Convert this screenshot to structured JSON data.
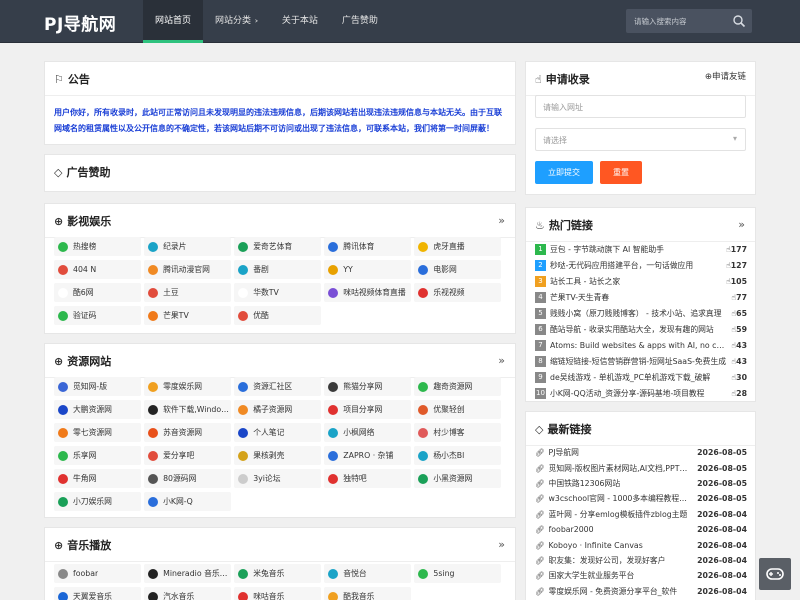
{
  "header": {
    "logo": "PJ导航网",
    "nav": [
      "网站首页",
      "网站分类",
      "关于本站",
      "广告赞助"
    ],
    "search_placeholder": "请输入搜索内容"
  },
  "notice": {
    "title": "公告",
    "text": "用户你好，所有收录时，此站可正常访问且未发现明显的违法违规信息，后期该网站若出现违法违规信息与本站无关。由于互联网域名的租赁属性以及公开信息的不确定性，若该网站后期不可访问或出现了违法信息，可联系本站，我们将第一时间屏蔽！"
  },
  "ads": {
    "title": "广告赞助"
  },
  "film": {
    "title": "影视娱乐",
    "links": [
      {
        "label": "热搜榜",
        "color": "#2db84d",
        "icon": "play-icon"
      },
      {
        "label": "纪录片",
        "color": "#1aa3c7",
        "icon": "tv-icon"
      },
      {
        "label": "爱奇艺体育",
        "color": "#1aa058",
        "icon": "tv-icon"
      },
      {
        "label": "腾讯体育",
        "color": "#2a6edb",
        "icon": "sport-icon"
      },
      {
        "label": "虎牙直播",
        "color": "#f0b400",
        "icon": "huya-icon"
      },
      {
        "label": "404 N",
        "color": "#e14c3c",
        "icon": "chrome-icon"
      },
      {
        "label": "腾讯动漫官网",
        "color": "#f08a24",
        "icon": "comic-icon"
      },
      {
        "label": "番剧",
        "color": "#1aa3c7",
        "icon": "tv-icon"
      },
      {
        "label": "YY",
        "color": "#e8a100",
        "icon": "yy-icon"
      },
      {
        "label": "电影网",
        "color": "#2a6edb",
        "icon": "film-icon"
      },
      {
        "label": "酷6网",
        "color": "#ffffff",
        "icon": "blank-icon"
      },
      {
        "label": "土豆",
        "color": "#e14c3c",
        "icon": "chrome-icon"
      },
      {
        "label": "华数TV",
        "color": "#ffffff",
        "icon": "blank-icon"
      },
      {
        "label": "咪咕视频体育直播",
        "color": "#7a4fd6",
        "icon": "migu-icon"
      },
      {
        "label": "乐视视频",
        "color": "#e0312f",
        "icon": "le-icon"
      },
      {
        "label": "验证码",
        "color": "#2db84d",
        "icon": "play-icon"
      },
      {
        "label": "芒果TV",
        "color": "#f07a1a",
        "icon": "mango-icon"
      },
      {
        "label": "优酷",
        "color": "#e14c3c",
        "icon": "chrome-icon"
      }
    ]
  },
  "resources": {
    "title": "资源网站",
    "links": [
      {
        "label": "觅知网-版",
        "color": "#3a66d6",
        "icon": "triangle-icon"
      },
      {
        "label": "零度娱乐网",
        "color": "#f0a020",
        "icon": "zero-icon"
      },
      {
        "label": "资源汇社区",
        "color": "#2a6edb",
        "icon": "wordpress-icon"
      },
      {
        "label": "熊猫分享网",
        "color": "#3a3a3a",
        "icon": "panda-icon"
      },
      {
        "label": "趣奇资源网",
        "color": "#2db84d",
        "icon": "qq-icon"
      },
      {
        "label": "大鹏资源网",
        "color": "#1a46c8",
        "icon": "bird-icon"
      },
      {
        "label": "软件下载,Windows软件",
        "color": "#222222",
        "icon": "apple-icon"
      },
      {
        "label": "橘子资源网",
        "color": "#f08a24",
        "icon": "orange-icon"
      },
      {
        "label": "项目分享网",
        "color": "#e0312f",
        "icon": "project-icon"
      },
      {
        "label": "优聚轻创",
        "color": "#e05a2a",
        "icon": "youju-icon"
      },
      {
        "label": "零七资源网",
        "color": "#f07a1a",
        "icon": "seven-icon"
      },
      {
        "label": "苏音资源网",
        "color": "#e8501a",
        "icon": "suyin-icon"
      },
      {
        "label": "个人笔记",
        "color": "#1a46c8",
        "icon": "note-icon"
      },
      {
        "label": "小枫网络",
        "color": "#1aa3c7",
        "icon": "leaf-icon"
      },
      {
        "label": "村少博客",
        "color": "#e05a5a",
        "icon": "village-icon"
      },
      {
        "label": "乐享网",
        "color": "#2db84d",
        "icon": "share-icon"
      },
      {
        "label": "爱分享吧",
        "color": "#e14c3c",
        "icon": "chrome-icon"
      },
      {
        "label": "果核剥壳",
        "color": "#d4a21a",
        "icon": "nut-icon"
      },
      {
        "label": "ZAPRO · 杂铺",
        "color": "#2a6edb",
        "icon": "zapro-icon"
      },
      {
        "label": "杨小杰Bl",
        "color": "#1aa3c7",
        "icon": "yang-icon"
      },
      {
        "label": "牛角网",
        "color": "#e0312f",
        "icon": "horn-icon"
      },
      {
        "label": "80源码网",
        "color": "#555555",
        "icon": "code-icon"
      },
      {
        "label": "3yi论坛",
        "color": "#cccccc",
        "icon": "forum-icon"
      },
      {
        "label": "独特吧",
        "color": "#e0312f",
        "icon": "unique-icon"
      },
      {
        "label": "小黑资源网",
        "color": "#1aa058",
        "icon": "black-icon"
      },
      {
        "label": "小刀娱乐网",
        "color": "#1aa058",
        "icon": "knife-icon"
      },
      {
        "label": "小K网-Q",
        "color": "#2a6edb",
        "icon": "k-icon"
      }
    ]
  },
  "music": {
    "title": "音乐播放",
    "links": [
      {
        "label": "foobar",
        "color": "#888888",
        "icon": "alien-icon"
      },
      {
        "label": "Mineradio 音乐电台",
        "color": "#222222",
        "icon": "radio-icon"
      },
      {
        "label": "米兔音乐",
        "color": "#1aa058",
        "icon": "rabbit-icon"
      },
      {
        "label": "音悦台",
        "color": "#1aa3c7",
        "icon": "music-icon"
      },
      {
        "label": "5sing",
        "color": "#2db84d",
        "icon": "sing-icon"
      },
      {
        "label": "天翼爱音乐",
        "color": "#1a66d6",
        "icon": "tianyi-icon"
      },
      {
        "label": "汽水音乐",
        "color": "#222222",
        "icon": "soda-icon"
      },
      {
        "label": "咪咕音乐",
        "color": "#e0312f",
        "icon": "migu-icon"
      },
      {
        "label": "酷我音乐",
        "color": "#f0a020",
        "icon": "kuwo-icon"
      }
    ]
  },
  "apply": {
    "title": "申请收录",
    "link_label": "申请友链",
    "url_placeholder": "请输入网址",
    "select_placeholder": "请选择",
    "submit_label": "立即提交",
    "reset_label": "重置",
    "submit_color": "#1e9fff",
    "reset_color": "#ff5722"
  },
  "hot": {
    "title": "热门链接",
    "items": [
      {
        "rank": "1",
        "text": "豆包 - 字节跳动旗下 AI 智能助手",
        "count": "177"
      },
      {
        "rank": "2",
        "text": "秒哒-无代码应用搭建平台，一句话做应用",
        "count": "127"
      },
      {
        "rank": "3",
        "text": "站长工具 - 站长之家",
        "count": "105"
      },
      {
        "rank": "4",
        "text": "芒果TV-天生青春",
        "count": "77"
      },
      {
        "rank": "5",
        "text": "贱贱小窝（原刀贱贱博客） - 技术小站、追求真理",
        "count": "65"
      },
      {
        "rank": "6",
        "text": "酷站导航 - 收录实用酷站大全，发现有趣的网站",
        "count": "59"
      },
      {
        "rank": "7",
        "text": "Atoms: Build websites & apps with AI, no code",
        "count": "43"
      },
      {
        "rank": "8",
        "text": "缩链短链接-短信营销群营销-短网址SaaS-免费生成",
        "count": "43"
      },
      {
        "rank": "9",
        "text": "de吴线游戏 - 单机游戏_PC单机游戏下载_破解",
        "count": "30"
      },
      {
        "rank": "10",
        "text": "小K网-QQ活动_资源分享-源码基地-项目教程",
        "count": "28"
      }
    ],
    "rank_colors": [
      "#2db84d",
      "#1e9fff",
      "#f0a020",
      "#888888"
    ]
  },
  "latest": {
    "title": "最新链接",
    "items": [
      {
        "text": "PJ导航网",
        "date": "2026-08-05"
      },
      {
        "text": "觅知网-版权图片素材网站,AI文档,PPT模板",
        "date": "2026-08-05"
      },
      {
        "text": "中国铁路12306网站",
        "date": "2026-08-05"
      },
      {
        "text": "w3cschool官网 - 1000多本编程教程免费学",
        "date": "2026-08-05"
      },
      {
        "text": "蓝叶网 - 分享emlog模板插件zblog主题",
        "date": "2026-08-04"
      },
      {
        "text": "foobar2000",
        "date": "2026-08-04"
      },
      {
        "text": "Koboyo · Infinite Canvas",
        "date": "2026-08-04"
      },
      {
        "text": "职友集：发现好公司，发现好客户",
        "date": "2026-08-04"
      },
      {
        "text": "国家大学生就业服务平台",
        "date": "2026-08-04"
      },
      {
        "text": "零度娱乐网 - 免费资源分享平台_软件",
        "date": "2026-08-04"
      }
    ]
  }
}
